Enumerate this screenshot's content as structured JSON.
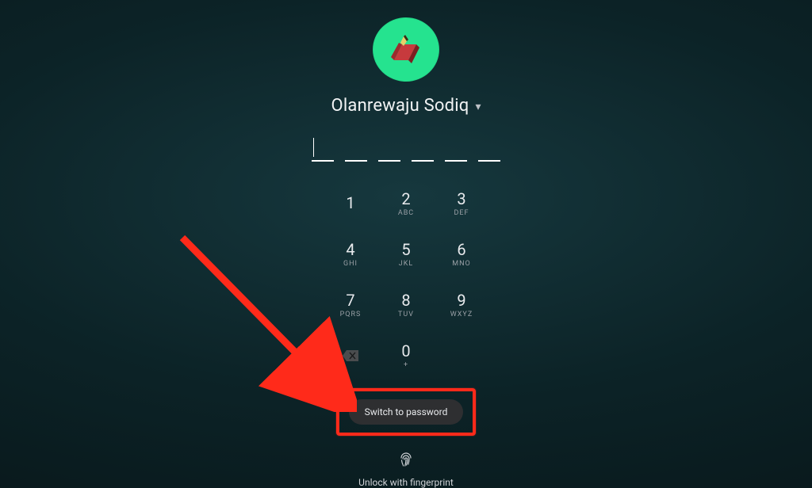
{
  "user": {
    "name": "Olanrewaju Sodiq"
  },
  "pin": {
    "length": 6
  },
  "keypad": [
    {
      "digit": "1",
      "letters": ""
    },
    {
      "digit": "2",
      "letters": "ABC"
    },
    {
      "digit": "3",
      "letters": "DEF"
    },
    {
      "digit": "4",
      "letters": "GHI"
    },
    {
      "digit": "5",
      "letters": "JKL"
    },
    {
      "digit": "6",
      "letters": "MNO"
    },
    {
      "digit": "7",
      "letters": "PQRS"
    },
    {
      "digit": "8",
      "letters": "TUV"
    },
    {
      "digit": "9",
      "letters": "WXYZ"
    },
    {
      "digit": "0",
      "letters": "+"
    }
  ],
  "actions": {
    "switch_label": "Switch to password"
  },
  "fingerprint": {
    "label": "Unlock with fingerprint"
  },
  "annotation": {
    "highlight_color": "#ff2a1a"
  }
}
